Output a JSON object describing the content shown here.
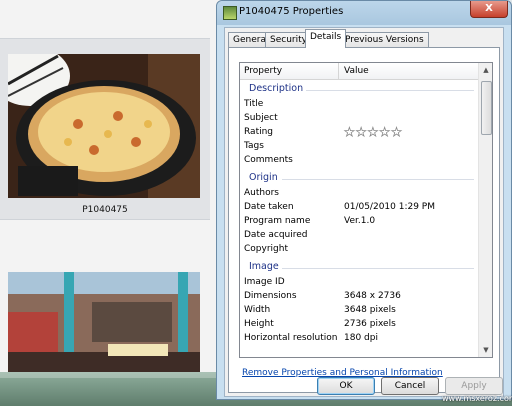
{
  "explorer": {
    "photo_label": "P1040475"
  },
  "dialog": {
    "title": "P1040475 Properties",
    "close_glyph": "X",
    "tabs": [
      {
        "label": "General"
      },
      {
        "label": "Security"
      },
      {
        "label": "Details"
      },
      {
        "label": "Previous Versions"
      }
    ],
    "columns": {
      "property": "Property",
      "value": "Value"
    },
    "groups": {
      "description": "Description",
      "origin": "Origin",
      "image": "Image"
    },
    "rows": {
      "title": {
        "p": "Title",
        "v": ""
      },
      "subject": {
        "p": "Subject",
        "v": ""
      },
      "rating": {
        "p": "Rating",
        "stars": 0,
        "max": 5
      },
      "tags": {
        "p": "Tags",
        "v": ""
      },
      "comments": {
        "p": "Comments",
        "v": ""
      },
      "authors": {
        "p": "Authors",
        "v": ""
      },
      "date_taken": {
        "p": "Date taken",
        "v": "01/05/2010 1:29 PM"
      },
      "program_name": {
        "p": "Program name",
        "v": "Ver.1.0"
      },
      "date_acquired": {
        "p": "Date acquired",
        "v": ""
      },
      "copyright": {
        "p": "Copyright",
        "v": ""
      },
      "image_id": {
        "p": "Image ID",
        "v": ""
      },
      "dimensions": {
        "p": "Dimensions",
        "v": "3648 x 2736"
      },
      "width": {
        "p": "Width",
        "v": "3648 pixels"
      },
      "height": {
        "p": "Height",
        "v": "2736 pixels"
      },
      "hres": {
        "p": "Horizontal resolution",
        "v": "180 dpi"
      }
    },
    "remove_link": "Remove Properties and Personal Information",
    "buttons": {
      "ok": "OK",
      "cancel": "Cancel",
      "apply": "Apply"
    }
  },
  "watermark": "www.msxeroz.com"
}
